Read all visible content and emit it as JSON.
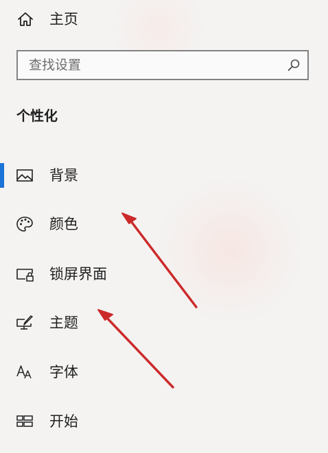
{
  "home": {
    "label": "主页",
    "icon": "home-icon"
  },
  "search": {
    "placeholder": "查找设置",
    "value": "",
    "icon": "search-icon"
  },
  "section_title": "个性化",
  "nav": {
    "selected": "背景",
    "accent_color": "#1a73d6",
    "items": [
      {
        "label": "背景",
        "icon": "picture-icon"
      },
      {
        "label": "颜色",
        "icon": "palette-icon"
      },
      {
        "label": "锁屏界面",
        "icon": "lock-screen-icon"
      },
      {
        "label": "主题",
        "icon": "theme-brush-icon"
      },
      {
        "label": "字体",
        "icon": "font-icon"
      },
      {
        "label": "开始",
        "icon": "start-tiles-icon"
      }
    ]
  },
  "annotation": {
    "arrow_color": "#cc2a2a",
    "arrow_count": 2
  }
}
